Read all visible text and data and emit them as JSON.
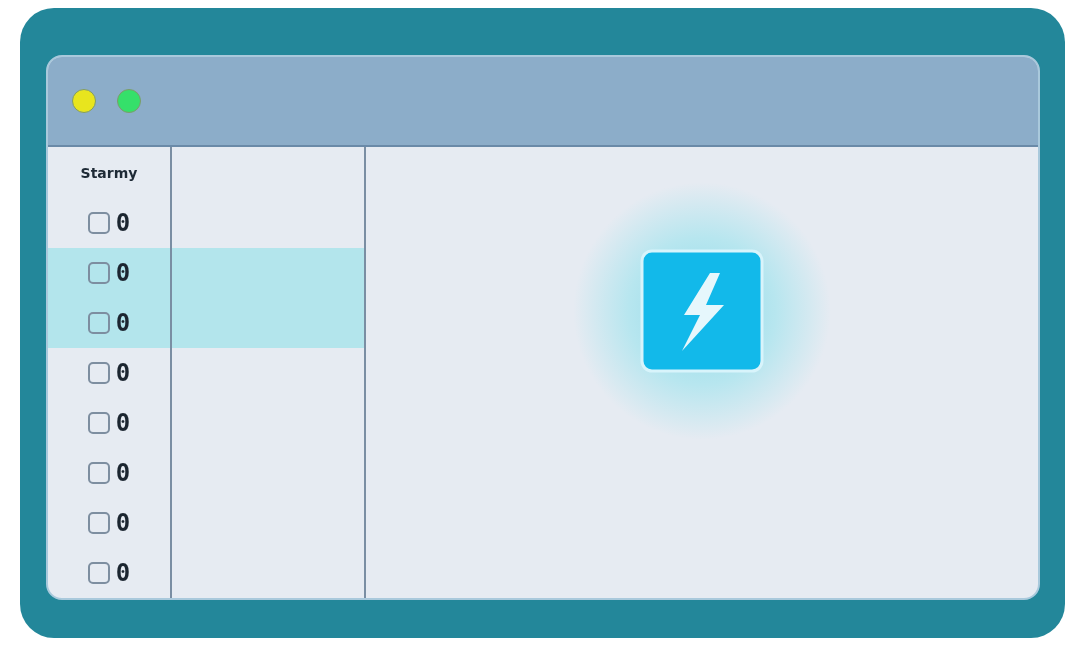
{
  "window": {
    "controls": [
      {
        "color": "#e8e51e"
      },
      {
        "color": "#35e06a"
      }
    ]
  },
  "sidebar": {
    "title": "Starmy",
    "rows": [
      {
        "checked": false,
        "label": "0",
        "selected": false
      },
      {
        "checked": false,
        "label": "0",
        "selected": true
      },
      {
        "checked": false,
        "label": "0",
        "selected": true
      },
      {
        "checked": false,
        "label": "0",
        "selected": false
      },
      {
        "checked": false,
        "label": "0",
        "selected": false
      },
      {
        "checked": false,
        "label": "0",
        "selected": false
      },
      {
        "checked": false,
        "label": "0",
        "selected": false
      },
      {
        "checked": false,
        "label": "0",
        "selected": false
      }
    ]
  }
}
